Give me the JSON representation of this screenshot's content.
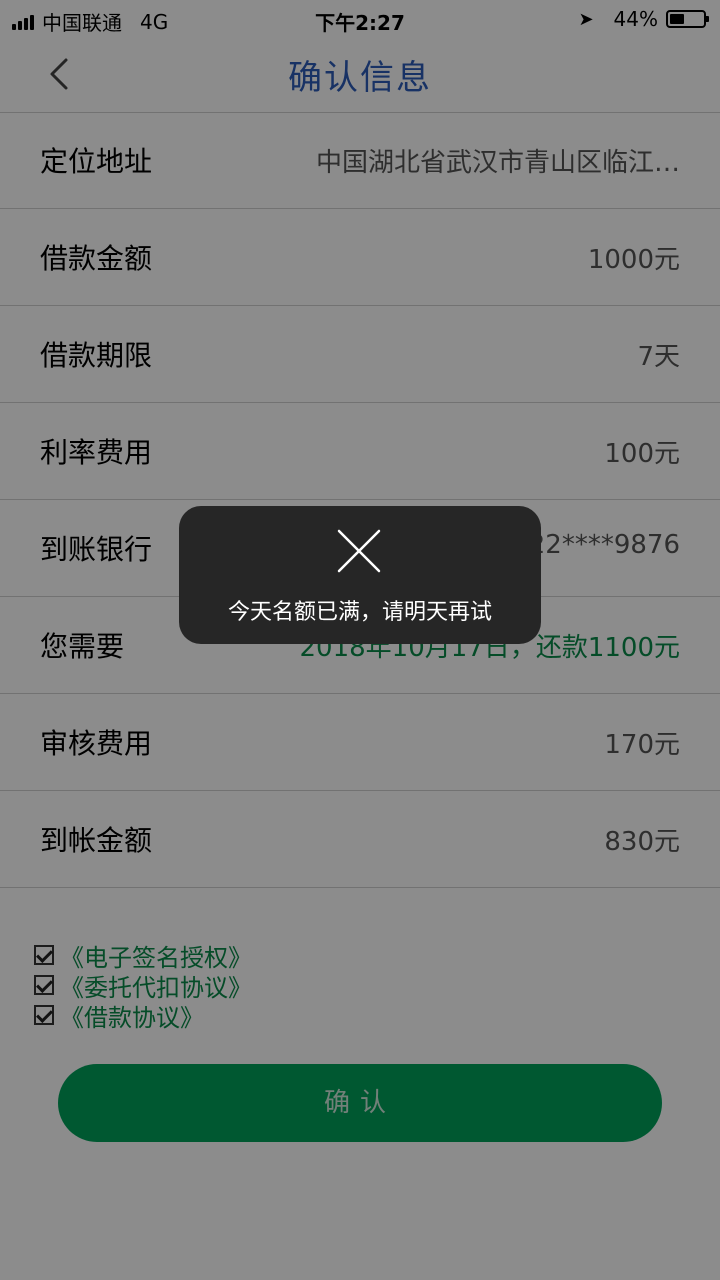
{
  "status_bar": {
    "carrier": "中国联通",
    "network": "4G",
    "time": "下午2:27",
    "battery": "44%",
    "battery_level": 0.44
  },
  "nav": {
    "back_icon": "chevron-left-icon",
    "title": "确认信息"
  },
  "rows": [
    {
      "label": "定位地址",
      "value": "中国湖北省武汉市青山区临江…"
    },
    {
      "label": "借款金额",
      "value": "1000元"
    },
    {
      "label": "借款期限",
      "value": "7天"
    },
    {
      "label": "利率费用",
      "value": "100元"
    },
    {
      "label": "到账银行",
      "value": "6222****9876"
    },
    {
      "label": "您需要",
      "value": "2018年10月17日，还款1100元"
    },
    {
      "label": "审核费用",
      "value": "170元"
    },
    {
      "label": "到帐金额",
      "value": "830元"
    }
  ],
  "agreements": [
    {
      "label": "《电子签名授权》",
      "checked": true
    },
    {
      "label": "《委托代扣协议》",
      "checked": true
    },
    {
      "label": "《借款协议》",
      "checked": true
    }
  ],
  "confirm_button": {
    "label": "确认"
  },
  "toast": {
    "icon": "close-icon",
    "message": "今天名额已满，请明天再试"
  },
  "colors": {
    "title_blue": "#2c5cb8",
    "accent_green": "#00a05a",
    "link_green": "#0a8a4a",
    "toast_bg": "#262626"
  }
}
